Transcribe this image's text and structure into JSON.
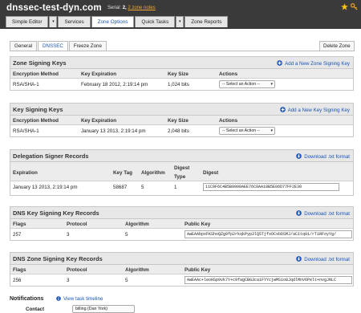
{
  "header": {
    "title": "dnssec-test-dyn.com",
    "serial_label": "Serial:",
    "serial_value": "2,",
    "notes_link": "2 zone notes"
  },
  "menu": {
    "items": [
      {
        "label": "Simple Editor"
      },
      {
        "label": "▾"
      },
      {
        "label": "Services"
      },
      {
        "label": "Zone Options"
      },
      {
        "label": "Quick Tasks"
      },
      {
        "label": "▾"
      },
      {
        "label": "Zone Reports"
      }
    ]
  },
  "subtabs": [
    {
      "label": "General"
    },
    {
      "label": "DNSSEC"
    },
    {
      "label": "Freeze Zone"
    }
  ],
  "delete_zone": "Delete Zone",
  "zsk": {
    "title": "Zone Signing Keys",
    "action": "Add a New Zone Signing Key",
    "cols": [
      "Encryption Method",
      "Key Expiration",
      "Key Size",
      "Actions"
    ],
    "row": {
      "method": "RSA/SHA-1",
      "expiration": "February 18 2012, 2:19:14 pm",
      "size": "1,024 bits",
      "action": "-- Select an Action --"
    }
  },
  "ksk": {
    "title": "Key Signing Keys",
    "action": "Add a New Key Signing Key",
    "cols": [
      "Encryption Method",
      "Key Expiration",
      "Key Size",
      "Actions"
    ],
    "row": {
      "method": "RSA/SHA-1",
      "expiration": "January 13 2013, 2:19:14 pm",
      "size": "2,048 bits",
      "action": "-- Select an Action --"
    }
  },
  "ds": {
    "title": "Delegation Signer Records",
    "action": "Download .txt format",
    "cols": [
      "Expiration",
      "Key Tag",
      "Algorithm",
      "Digest",
      "Type",
      "Digest"
    ],
    "row": {
      "expiration": "January 13 2013, 2:19:14 pm",
      "tag": "58687",
      "algorithm": "5",
      "type": "1",
      "digest": "11C9F6C4B5B9998AEE76C8AA18B5E06D77FF2E30"
    }
  },
  "dnskey_ksk": {
    "title": "DNS Key Signing Key Records",
    "action": "Download .txt format",
    "cols": [
      "Flags",
      "Protocol",
      "Algorithm",
      "Public Key"
    ],
    "row": {
      "flags": "257",
      "protocol": "3",
      "algorithm": "5",
      "key": "AwEAAbpxFKShoQZg9fp2rkqkPyp3lQ5TjfxOCsbDSMJ/aC1tq01/rTiRFoyYg/"
    }
  },
  "dnskey_zsk": {
    "title": "DNS Zone Signing Key Records",
    "action": "Download .txt format",
    "cols": [
      "Flags",
      "Protocol",
      "Algorithm",
      "Public Key"
    ],
    "row": {
      "flags": "256",
      "protocol": "3",
      "algorithm": "5",
      "key": "AwEAAc+leoHSp9vk7Y+c9fagCBG3caiFYYcjwMSio8JqdlMnV6Pelt+nvgJNLC"
    }
  },
  "notifications": {
    "title": "Notifications",
    "timeline": "View task timeline",
    "contact_label": "Contact",
    "contact_value": "billing (Dan York)"
  },
  "colors": {
    "accent": "#1a56b8",
    "topbar": "#3a3a3a",
    "notes": "#f0a830"
  }
}
